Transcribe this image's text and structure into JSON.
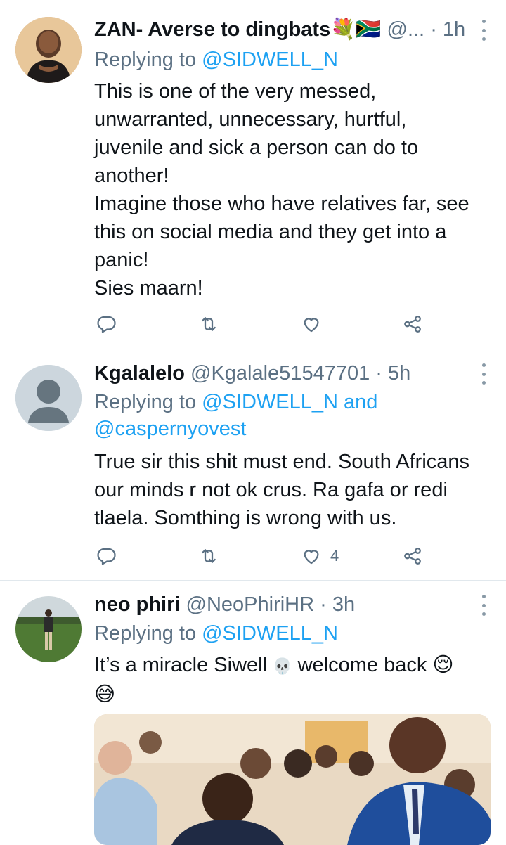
{
  "tweets": [
    {
      "display_name": "ZAN- Averse to dingbats",
      "handle": "@...",
      "time": "1h",
      "flag_emoji": "💐🇿🇦",
      "reply_prefix": "Replying to",
      "reply_to": "@SIDWELL_N",
      "reply_to_extra_joiner": "",
      "reply_to_extra": "",
      "lines": [
        "This is one of the very messed,",
        "unwarranted, unnecessary, hurtful,",
        "juvenile and sick a person can do to",
        "another!",
        "Imagine those who have relatives far, see",
        "this on social media and they get into a",
        "panic!",
        "Sies maarn!"
      ],
      "like_count": ""
    },
    {
      "display_name": "Kgalalelo",
      "handle": "@Kgalale51547701",
      "time": "5h",
      "reply_prefix": "Replying to",
      "reply_to": "@SIDWELL_N",
      "reply_to_extra_joiner": "and",
      "reply_to_extra": "@caspernyovest",
      "lines": [
        "True sir this shit must end. South Africans",
        "our minds r not ok crus. Ra gafa or redi",
        "tlaela. Somthing is wrong with us."
      ],
      "like_count": "4"
    },
    {
      "display_name": "neo phiri",
      "handle": "@NeoPhiriHR",
      "time": "3h",
      "reply_prefix": "Replying to",
      "reply_to": "@SIDWELL_N",
      "line_before_skull": "It’s a miracle Siwell",
      "line_after_skull": "welcome back",
      "emoji_skull": "💀",
      "emoji_relieved": "😌",
      "emoji_sweat_smile": "😅"
    }
  ],
  "icons": {
    "reply": "reply-icon",
    "retweet": "retweet-icon",
    "like": "heart-icon",
    "share": "share-icon",
    "more": "more-options-icon"
  },
  "colors": {
    "link": "#1da1f2",
    "secondary_text": "#5b7083",
    "primary_text": "#0f1419",
    "divider": "#e1e8ed"
  }
}
